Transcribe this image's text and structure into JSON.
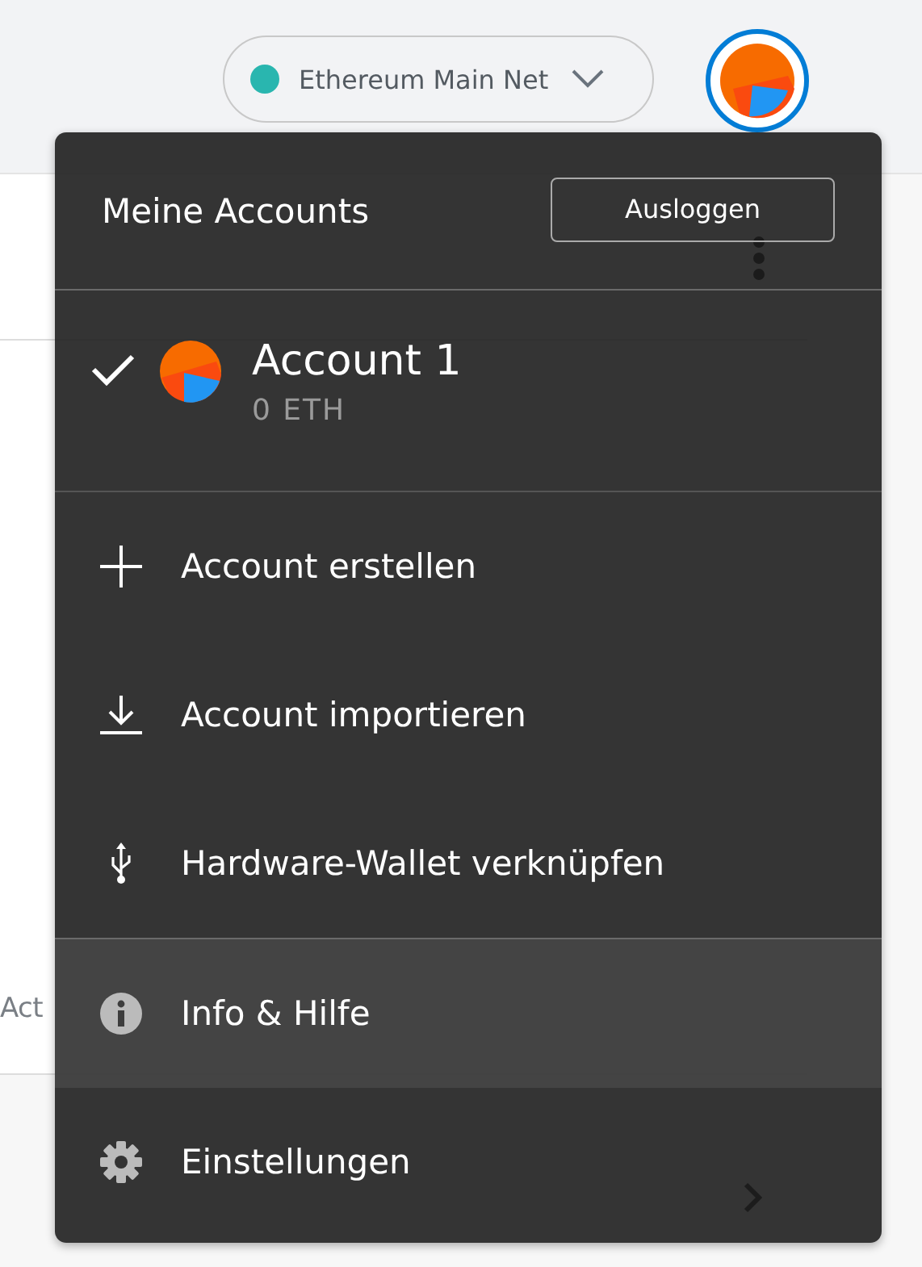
{
  "network": {
    "label": "Ethereum Main Net",
    "color": "#29b6af"
  },
  "background": {
    "tab": "Act"
  },
  "menu": {
    "title": "Meine Accounts",
    "logout_button": "Ausloggen",
    "accounts": [
      {
        "name": "Account 1",
        "balance": "0 ETH",
        "selected": true
      }
    ],
    "items": [
      {
        "kind": "create",
        "label": "Account erstellen",
        "selected": false
      },
      {
        "kind": "import",
        "label": "Account importieren",
        "selected": false
      },
      {
        "kind": "hardware",
        "label": "Hardware-Wallet verknüpfen",
        "selected": false
      },
      {
        "kind": "info",
        "label": "Info & Hilfe",
        "selected": true
      },
      {
        "kind": "settings",
        "label": "Einstellungen",
        "selected": false
      }
    ]
  }
}
